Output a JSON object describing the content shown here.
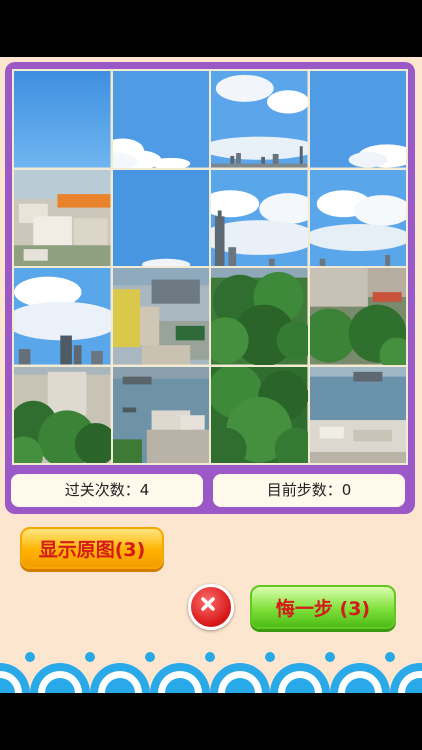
{
  "stats": {
    "levels_cleared_label": "过关次数：4",
    "current_steps_label": "目前步数：0"
  },
  "buttons": {
    "show_original_label": "显示原图(3)",
    "undo_label": "悔一步 (3)"
  },
  "colors": {
    "background": "#fde6cf",
    "frame": "#9b59c8",
    "counter_bg": "#fff9ec",
    "orange_button": "#ffb300",
    "green_button": "#7fe03a",
    "button_text": "#d41a1a",
    "wave": "#29a9e8"
  },
  "icons": {
    "close": "close-icon"
  }
}
